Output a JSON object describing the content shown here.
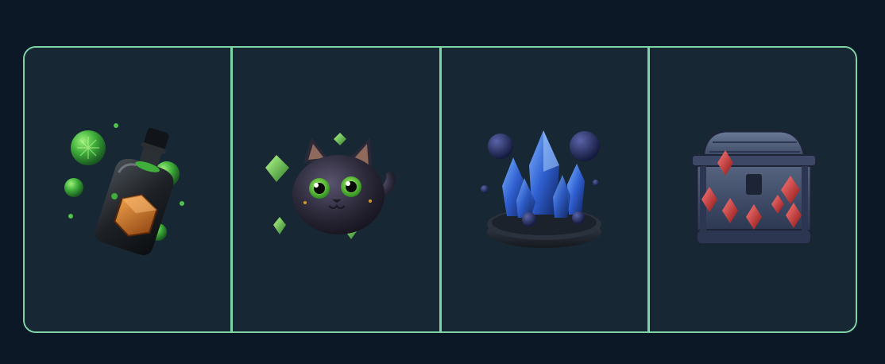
{
  "header": {
    "title_fragment": ""
  },
  "colors": {
    "background": "#0c1826",
    "panel": "#172733",
    "frame_border": "#7fd4a6"
  },
  "items": [
    {
      "icon": "potion-bottle-icon",
      "selected": false
    },
    {
      "icon": "cat-creature-icon",
      "selected": false
    },
    {
      "icon": "crystal-cluster-icon",
      "selected": false
    },
    {
      "icon": "treasure-chest-icon",
      "selected": false
    }
  ]
}
